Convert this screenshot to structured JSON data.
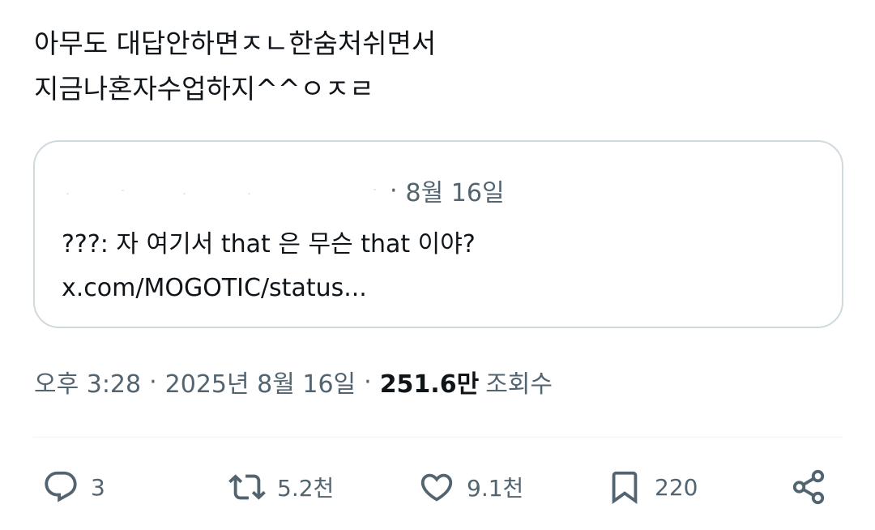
{
  "tweet": {
    "lines": [
      "아무도 대답안하면ㅈㄴ한숨처쉬면서",
      "지금나혼자수업하지^^ㅇㅈㄹ"
    ]
  },
  "quote": {
    "date": "8월 16일",
    "separator": "·",
    "lines": [
      "???: 자 여기서 that 은 무슨 that 이야?",
      "x.com/MOGOTIC/status..."
    ]
  },
  "meta": {
    "time": "오후 3:28",
    "date": "2025년 8월 16일",
    "separator": "·",
    "views_count": "251.6만",
    "views_label": "조회수"
  },
  "actions": {
    "replies": "3",
    "retweets": "5.2천",
    "likes": "9.1천",
    "bookmarks": "220"
  },
  "icons": {
    "reply": "reply-bubble-icon",
    "retweet": "retweet-arrows-icon",
    "like": "heart-outline-icon",
    "bookmark": "bookmark-outline-icon",
    "share": "share-nodes-icon"
  },
  "colors": {
    "text_primary": "#0f1419",
    "text_secondary": "#536471",
    "border": "#cfd9de"
  }
}
